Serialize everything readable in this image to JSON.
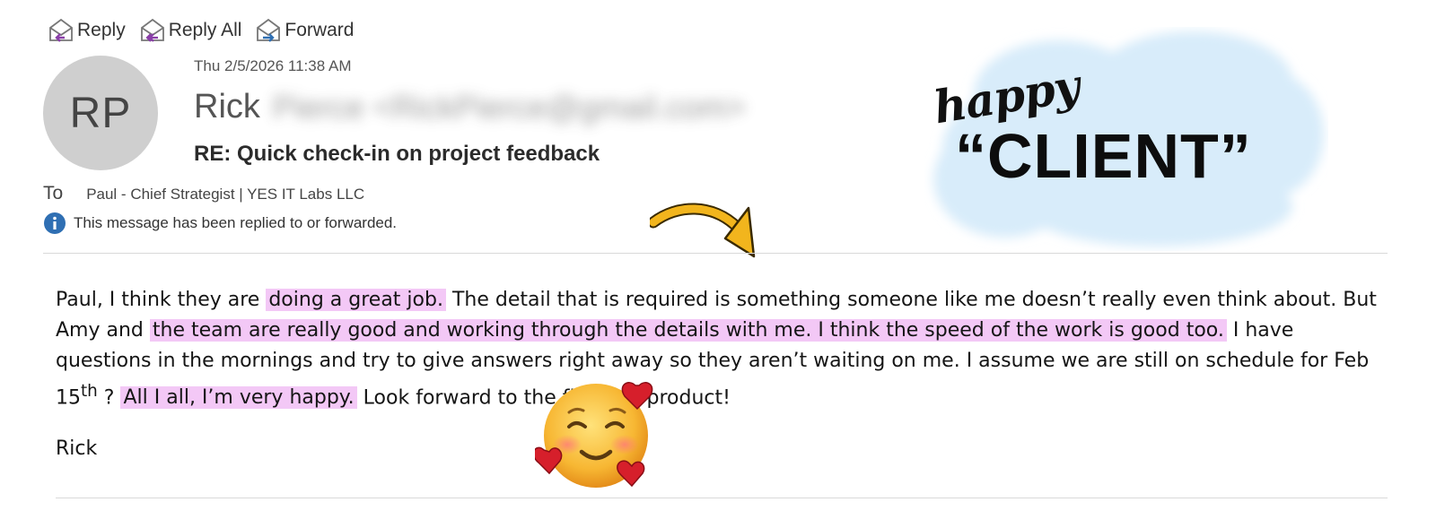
{
  "toolbar": {
    "reply_label": "Reply",
    "reply_all_label": "Reply All",
    "forward_label": "Forward"
  },
  "email": {
    "avatar_initials": "RP",
    "date": "Thu 2/5/2026 11:38 AM",
    "sender_first": "Rick",
    "sender_rest": "Pierce <RickPierce@gmail.com>",
    "subject": "RE: Quick check-in on project feedback",
    "to_label": "To",
    "to_value": "Paul - Chief Strategist | YES IT Labs LLC",
    "info_message": "This message has been replied to or forwarded."
  },
  "body": {
    "t1": "Paul, I think they are ",
    "h1": "doing a great job.",
    "t2": " The detail that is required is something someone like me doesn’t really even think about.  But Amy and ",
    "h2": "the team are really good and working through the details with me.   I think the speed of the work is good too.",
    "t3": " I have questions in the mornings and try to give answers right away so they aren’t waiting on me.  I assume we are still on schedule for Feb 15",
    "sup": "th",
    "t4": " ? ",
    "h3": "All I all, I’m very happy.",
    "t5": " Look forward to the finished product!",
    "signature": "Rick"
  },
  "sticker": {
    "line1": "happy",
    "line2": "“CLIENT”"
  },
  "colors": {
    "highlight": "#f3c8f6",
    "cloud": "#d8ecfa",
    "arrow": "#f2b51d",
    "info_icon": "#2f6fb3",
    "avatar_bg": "#cfcfcf"
  },
  "icons": [
    "reply-icon",
    "reply-all-icon",
    "forward-icon",
    "info-icon",
    "arrow-icon",
    "smiling-face-with-hearts-emoji"
  ]
}
